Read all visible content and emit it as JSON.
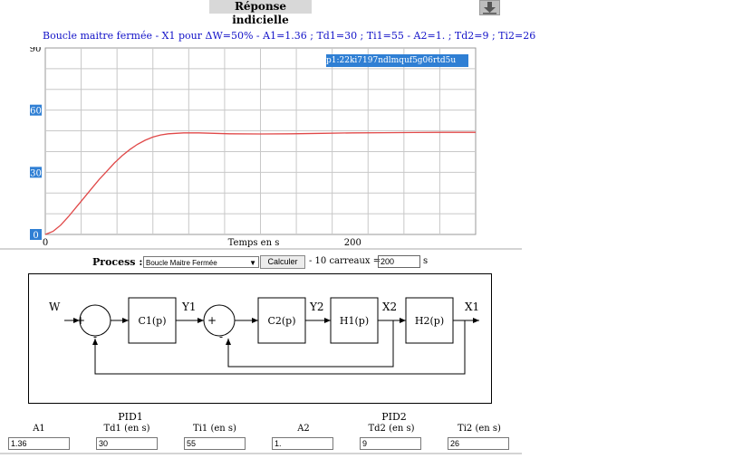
{
  "page": {
    "title": "Réponse indicielle"
  },
  "chart_data": {
    "type": "line",
    "title": "Boucle maitre fermée - X1 pour ΔW=50% - A1=1.36 ; Td1=30 ; Ti1=55 - A2=1. ; Td2=9 ; Ti2=26",
    "legend_text": "p1:22ki7197ndlmquf5g06rtd5u",
    "xlabel": "Temps en s",
    "ylabel": "",
    "xlim": [
      0,
      280
    ],
    "ylim": [
      0,
      90
    ],
    "grid": true,
    "x_ticks": [
      {
        "value": 0,
        "label": "0"
      },
      {
        "value": 200,
        "label": "200"
      }
    ],
    "y_ticks": [
      {
        "value": 0,
        "label": "0"
      },
      {
        "value": 30,
        "label": "30"
      },
      {
        "value": 60,
        "label": "60"
      },
      {
        "value": 90,
        "label": "90"
      }
    ],
    "series": [
      {
        "color": "#e04848",
        "x": [
          0,
          5,
          10,
          15,
          20,
          25,
          30,
          35,
          40,
          45,
          50,
          55,
          60,
          65,
          70,
          75,
          80,
          90,
          100,
          110,
          120,
          140,
          160,
          180,
          200,
          220,
          240,
          260,
          280
        ],
        "y": [
          0,
          1.5,
          4.5,
          8.5,
          13,
          17.5,
          22,
          26.5,
          30.5,
          34.5,
          38,
          41,
          43.5,
          45.5,
          47,
          48,
          48.6,
          49,
          49,
          48.8,
          48.6,
          48.5,
          48.6,
          48.8,
          49,
          49.1,
          49.2,
          49.3,
          49.3
        ]
      }
    ]
  },
  "process": {
    "label": "Process :",
    "selected": "Boucle Maitre Fermée",
    "calc_label": "Calculer",
    "carreaux_text": "- 10 carreaux =",
    "scale_value": "200",
    "unit": "s"
  },
  "diagram": {
    "W": "W",
    "plus": "+",
    "minus": "-",
    "C1": "C1(p)",
    "Y1": "Y1",
    "C2": "C2(p)",
    "Y2": "Y2",
    "H1": "H1(p)",
    "X2": "X2",
    "H2": "H2(p)",
    "X1": "X1"
  },
  "params": {
    "pid1_header": "PID1",
    "pid2_header": "PID2",
    "A1_label": "A1",
    "A1_value": "1.36",
    "Td1_label": "Td1 (en s)",
    "Td1_value": "30",
    "Ti1_label": "Ti1 (en s)",
    "Ti1_value": "55",
    "A2_label": "A2",
    "A2_value": "1.",
    "Td2_label": "Td2 (en s)",
    "Td2_value": "9",
    "Ti2_label": "Ti2 (en s)",
    "Ti2_value": "26"
  }
}
